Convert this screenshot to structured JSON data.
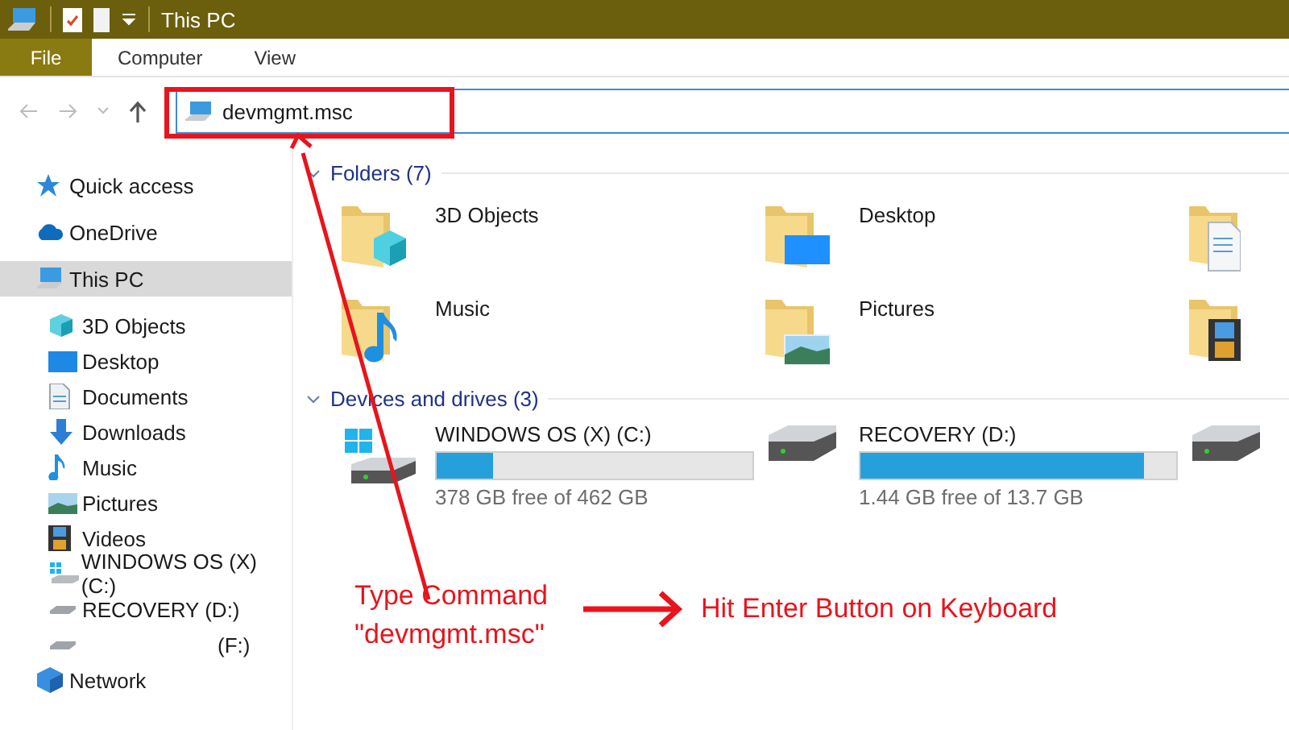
{
  "window": {
    "title": "This PC"
  },
  "ribbon_tabs": [
    {
      "label": "File",
      "selected": true
    },
    {
      "label": "Computer",
      "selected": false
    },
    {
      "label": "View",
      "selected": false
    }
  ],
  "address_bar": {
    "value": "devmgmt.msc",
    "highlighted": true
  },
  "sidebar": {
    "items": [
      {
        "label": "Quick access",
        "kind": "star",
        "selected": false
      },
      {
        "label": "OneDrive",
        "kind": "cloud",
        "selected": false
      },
      {
        "label": "This PC",
        "kind": "pc",
        "selected": true,
        "children": [
          {
            "label": "3D Objects",
            "kind": "cube",
            "selected": false
          },
          {
            "label": "Desktop",
            "kind": "desktop",
            "selected": false
          },
          {
            "label": "Documents",
            "kind": "documents",
            "selected": false
          },
          {
            "label": "Downloads",
            "kind": "download",
            "selected": false
          },
          {
            "label": "Music",
            "kind": "music",
            "selected": false
          },
          {
            "label": "Pictures",
            "kind": "pictures",
            "selected": false
          },
          {
            "label": "Videos",
            "kind": "videos",
            "selected": false
          },
          {
            "label": "WINDOWS OS (X) (C:)",
            "kind": "windrive",
            "selected": false
          },
          {
            "label": "RECOVERY (D:)",
            "kind": "drive",
            "selected": false
          },
          {
            "label": "(F:)",
            "kind": "drive-unnamed",
            "selected": false
          }
        ]
      },
      {
        "label": "Network",
        "kind": "network",
        "selected": false
      }
    ]
  },
  "folders": {
    "title": "Folders (7)",
    "expanded": true,
    "items": [
      {
        "label": "3D Objects",
        "kind": "cube"
      },
      {
        "label": "Desktop",
        "kind": "desktop"
      },
      {
        "kind": "documents"
      },
      {
        "label": "Music",
        "kind": "music"
      },
      {
        "label": "Pictures",
        "kind": "pictures"
      },
      {
        "kind": "videos"
      }
    ]
  },
  "drives": {
    "title": "Devices and drives (3)",
    "expanded": true,
    "items": [
      {
        "label": "WINDOWS OS (X) (C:)",
        "kind": "windrive",
        "level": 0.18,
        "free": "378 GB free of 462 GB"
      },
      {
        "label": "RECOVERY (D:)",
        "kind": "drive",
        "level": 0.9,
        "free": "1.44 GB free of 13.7 GB"
      },
      {
        "kind": "drive"
      }
    ]
  },
  "annotations": [
    {
      "text": "Type Command\n\"devmgmt.msc\"",
      "kind": "pointer"
    },
    {
      "text": "Hit Enter Button on Keyboard",
      "kind": "arrow"
    }
  ]
}
